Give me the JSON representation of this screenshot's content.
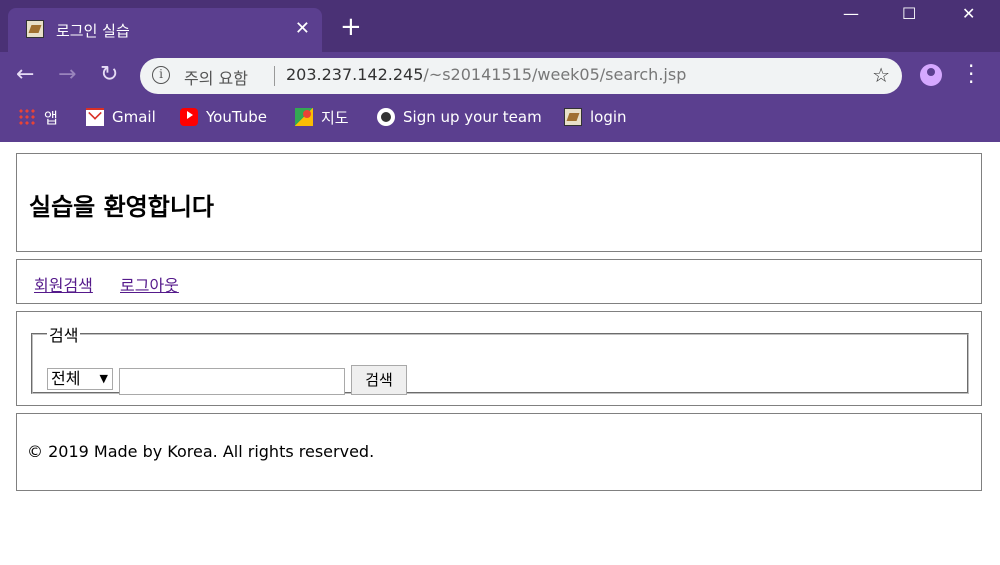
{
  "browser": {
    "tab_title": "로그인 실습",
    "tab_close": "✕",
    "new_tab": "+",
    "window": {
      "minimize": "—",
      "maximize": "☐",
      "close": "✕"
    },
    "nav": {
      "back": "←",
      "forward": "→",
      "reload": "↻"
    },
    "omnibox": {
      "warning": "주의 요함",
      "url_host": "203.237.142.245",
      "url_path": "/~s20141515/week05/search.jsp"
    },
    "bookmarks": [
      {
        "label": "앱",
        "icon": "apps-icon"
      },
      {
        "label": "Gmail",
        "icon": "gmail-icon"
      },
      {
        "label": "YouTube",
        "icon": "youtube-icon"
      },
      {
        "label": "지도",
        "icon": "maps-icon"
      },
      {
        "label": "Sign up your team",
        "icon": "github-icon"
      },
      {
        "label": "login",
        "icon": "login-favicon-icon"
      }
    ],
    "theme_color": "#5b3f8f"
  },
  "page": {
    "header_title": "실습을 환영합니다",
    "nav_links": [
      "회원검색",
      "로그아웃"
    ],
    "search": {
      "legend": "검색",
      "select_value": "전체",
      "input_value": "",
      "button_label": "검색"
    },
    "footer_text": "© 2019 Made by Korea. All rights reserved.",
    "link_color": "#551a8b"
  }
}
